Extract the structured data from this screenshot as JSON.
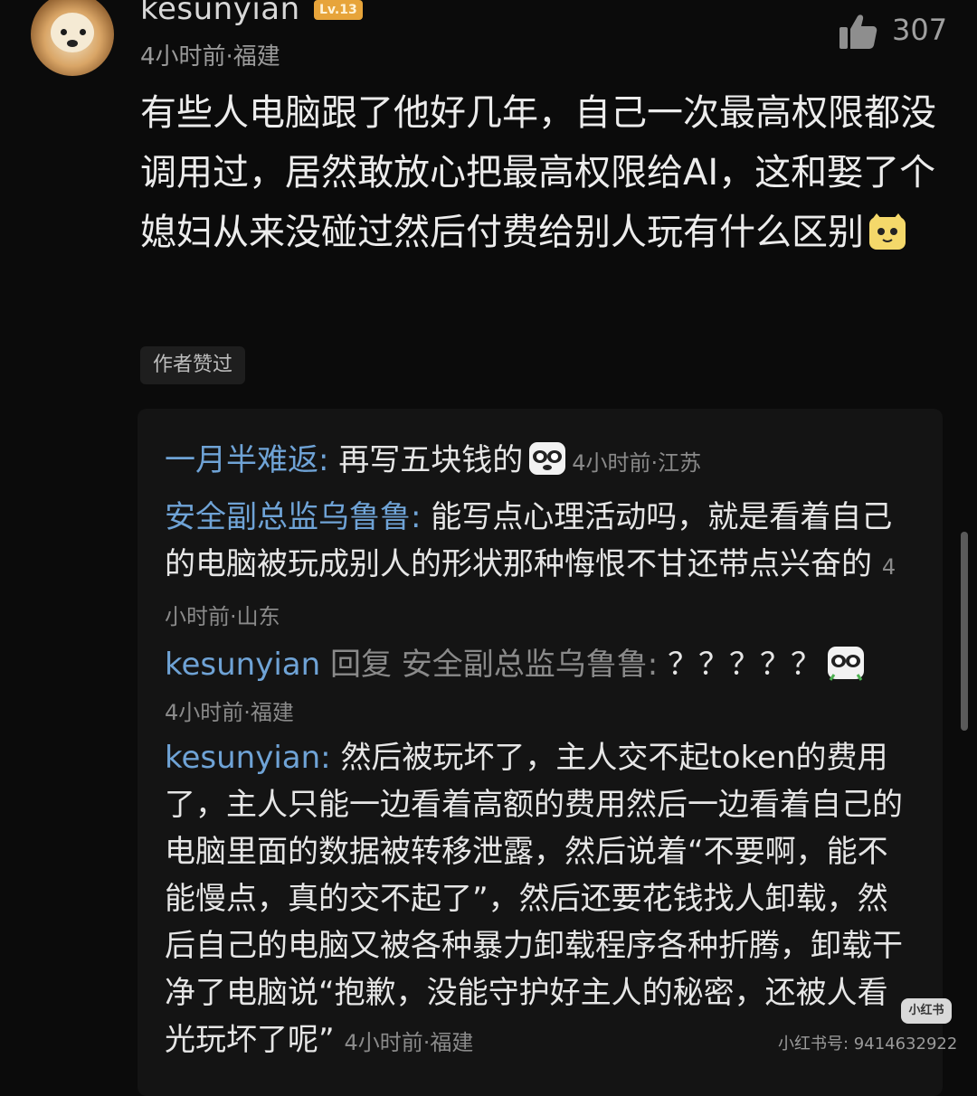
{
  "comment": {
    "username": "kesunyian",
    "level": "Lv.13",
    "meta": "4小时前·福建",
    "likes": "307",
    "text": "有些人电脑跟了他好几年，自己一次最高权限都没调用过，居然敢放心把最高权限给AI，这和娶了个媳妇从来没碰过然后付费给别人玩有什么区别",
    "author_badge": "作者赞过"
  },
  "replies": [
    {
      "nick": "一月半难返",
      "sep": ": ",
      "text": "再写五块钱的",
      "time": "4小时前·江苏"
    },
    {
      "nick": "安全副总监乌鲁鲁",
      "sep": ": ",
      "text": "能写点心理活动吗，就是看着自己的电脑被玩成别人的形状那种悔恨不甘还带点兴奋的",
      "time": "4小时前·山东"
    },
    {
      "nick": "kesunyian",
      "reply_word": "回复",
      "reply_to": "安全副总监乌鲁鲁",
      "sep": ": ",
      "text": "？？？？？",
      "time": "4小时前·福建"
    },
    {
      "nick": "kesunyian",
      "sep": ": ",
      "text": "然后被玩坏了，主人交不起token的费用了，主人只能一边看着高额的费用然后一边看着自己的电脑里面的数据被转移泄露，然后说着“不要啊，能不能慢点，真的交不起了”，然后还要花钱找人卸载，然后自己的电脑又被各种暴力卸载程序各种折腾，卸载干净了电脑说“抱歉，没能守护好主人的秘密，还被人看光玩坏了呢”",
      "time": "4小时前·福建"
    }
  ],
  "watermark": {
    "logo": "小红书",
    "id": "小红书号: 9414632922"
  },
  "colors": {
    "nick": "#6fa3d6",
    "background": "#0b0b0b",
    "level_badge": "#e7a43a"
  },
  "icons": [
    "thumbs-up-icon",
    "cat-emoji-icon",
    "panda-emoji-icon"
  ]
}
